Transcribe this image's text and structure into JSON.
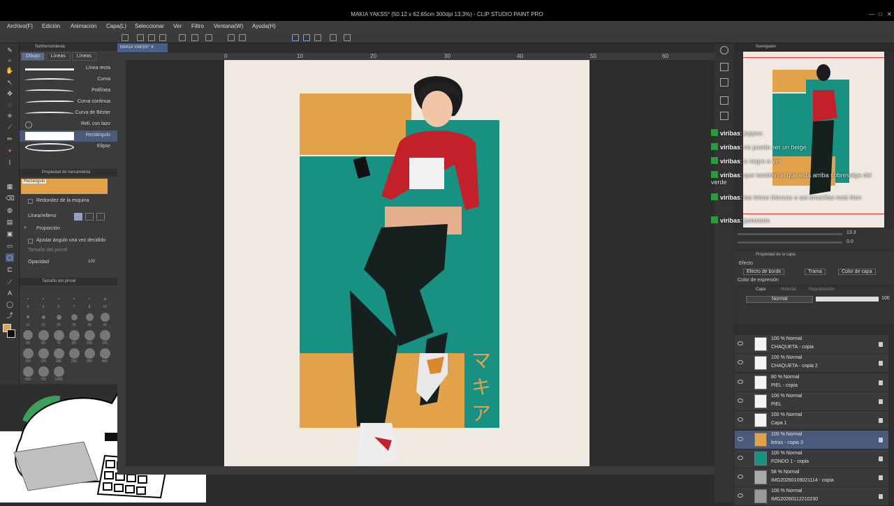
{
  "window": {
    "title": "MAKIA YAKSS* (50.12 x 62.65cm 300dpi 13.3%) - CLIP STUDIO PAINT PRO"
  },
  "menu": [
    "Archivo(F)",
    "Edición",
    "Animación",
    "Capa(L)",
    "Seleccionar",
    "Ver",
    "Filtro",
    "Ventana(W)",
    "Ayuda(H)"
  ],
  "sub_tool": {
    "header": "Subherramienta",
    "tabs": [
      "Dibujo",
      "Líneas",
      "Líneas"
    ],
    "items": [
      "Línea recta",
      "Curva",
      "Polilínea",
      "Curva continua",
      "Curva de Bézier",
      "Rell. con lazo",
      "Rectángulo",
      "Elipse"
    ]
  },
  "tool_property": {
    "header": "Propiedad de herramienta",
    "preview_label": "Rectángulo",
    "rows": [
      "Redondez de la esquina",
      "Línea/relleno",
      "Proporción",
      "Ajustar ángulo una vez decidido",
      "Tamaño del pincel",
      "Opacidad"
    ],
    "opacity_value": "100"
  },
  "brush_size": {
    "header": "Tamaño del pincel",
    "labels": [
      "4",
      "5",
      "6",
      "7",
      "8",
      "10",
      "12",
      "15",
      "20",
      "25",
      "30",
      "40",
      "50",
      "60",
      "70",
      "80",
      "100",
      "120",
      "150",
      "170",
      "200",
      "250",
      "300",
      "400",
      "500",
      "700",
      "1000"
    ]
  },
  "document_tab": "MAKIA YAKSS*",
  "ruler_marks": [
    "0",
    "10",
    "20",
    "30",
    "40",
    "50",
    "60"
  ],
  "artwork": {
    "colors": {
      "paper": "#efe9e1",
      "orange": "#e1a24a",
      "teal": "#189182",
      "jacket": "#c4202c"
    },
    "katakana": [
      "マ",
      "キ",
      "ア"
    ]
  },
  "navigator": {
    "header": "Navegador",
    "zoom": "13.3",
    "angle": "0.0"
  },
  "layer_property": {
    "header": "Propiedad de la capa",
    "effect_label": "Efecto",
    "buttons": [
      "Efecto de borde",
      "Trama",
      "Color de capa"
    ],
    "expression_color": "Color de expresión"
  },
  "layer_panel": {
    "tabs": [
      "Capa",
      "Historial",
      "Reproducción"
    ],
    "blend_mode": "Normal",
    "opacity": "100",
    "layers": [
      {
        "mode": "100 % Normal",
        "name": "CHAQUETA - copia"
      },
      {
        "mode": "100 % Normal",
        "name": "CHAQUETA - copia 2"
      },
      {
        "mode": "80 % Normal",
        "name": "PIEL - copia"
      },
      {
        "mode": "100 % Normal",
        "name": "PIEL"
      },
      {
        "mode": "100 % Normal",
        "name": "Capa 1"
      },
      {
        "mode": "100 % Normal",
        "name": "letras - copia 3"
      },
      {
        "mode": "100 % Normal",
        "name": "FONDO 1 - copia"
      },
      {
        "mode": "58 % Normal",
        "name": "IMG20260109021114 - copia"
      },
      {
        "mode": "100 % Normal",
        "name": "IMG20260112210230"
      }
    ]
  },
  "chat": [
    {
      "user": "viribas",
      "msg": ": joppas"
    },
    {
      "user": "viribas",
      "msg": ": no puede ser un beige"
    },
    {
      "user": "viribas",
      "msg": ": o negro a ver"
    },
    {
      "user": "viribas",
      "msg": ": que tambien el que esta arriba sobresalga del verde"
    },
    {
      "user": "viribas",
      "msg": ": las letras blancas o asi amarillas está bien"
    },
    {
      "user": "viribas",
      "msg": ": jummmm"
    }
  ]
}
